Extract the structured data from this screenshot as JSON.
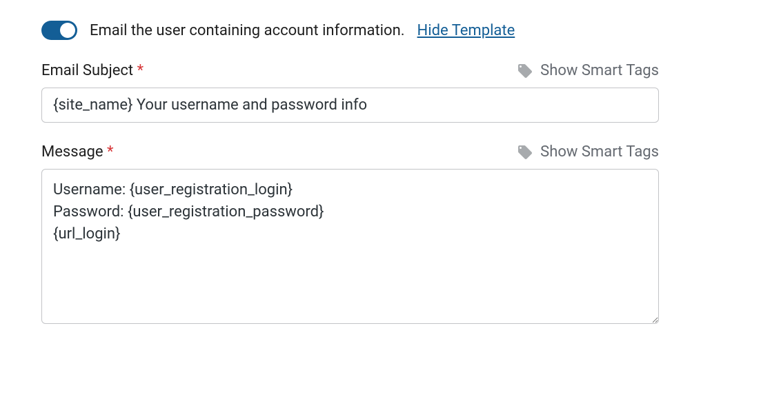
{
  "toggle": {
    "label": "Email the user containing account information.",
    "link": "Hide Template"
  },
  "subject": {
    "label": "Email Subject",
    "value": "{site_name} Your username and password info",
    "smartTags": "Show Smart Tags"
  },
  "message": {
    "label": "Message",
    "value": "Username: {user_registration_login}\nPassword: {user_registration_password}\n{url_login}",
    "smartTags": "Show Smart Tags"
  }
}
